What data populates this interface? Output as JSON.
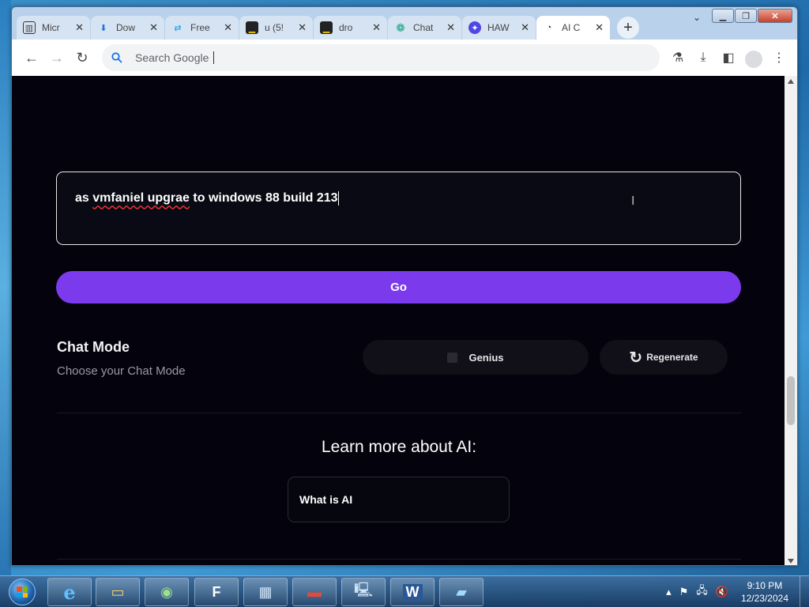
{
  "browser": {
    "tabs": [
      {
        "title": "Micr",
        "icon": "document-icon",
        "color": "#333333"
      },
      {
        "title": "Dow",
        "icon": "download-icon",
        "color": "#1a73e8"
      },
      {
        "title": "Free",
        "icon": "convert-icon",
        "color": "#1a9be0"
      },
      {
        "title": "u (5!",
        "icon": "terminal-icon",
        "color": "#222222"
      },
      {
        "title": "dro",
        "icon": "terminal-icon",
        "color": "#222222"
      },
      {
        "title": "Chat",
        "icon": "openai-icon",
        "color": "#10a37f"
      },
      {
        "title": "HAW",
        "icon": "star-icon",
        "color": "#4f46e5"
      },
      {
        "title": "AI C",
        "icon": "loading-icon",
        "color": "#333333"
      }
    ],
    "omnibox_placeholder": "Search Google"
  },
  "page": {
    "prompt_text_pre": "as ",
    "prompt_text_misspelled": "vmfaniel upgrae",
    "prompt_text_post": " to windows 88 build 213",
    "go_label": "Go",
    "chat_mode_title": "Chat Mode",
    "chat_mode_subtitle": "Choose your Chat Mode",
    "genius_label": "Genius",
    "genius_checked": false,
    "regenerate_label": "Regenerate",
    "learn_title": "Learn more about AI:",
    "what_card_label": "What is AI"
  },
  "taskbar": {
    "apps": [
      "internet-explorer-icon",
      "file-explorer-icon",
      "media-icon",
      "ftp-icon",
      "network-icon",
      "toolbox-icon",
      "computer-icon",
      "word-icon",
      "notepad-icon"
    ],
    "time": "9:10 PM",
    "date": "12/23/2024"
  },
  "colors": {
    "accent": "#7c3aed",
    "page_bg": "#03020d"
  }
}
